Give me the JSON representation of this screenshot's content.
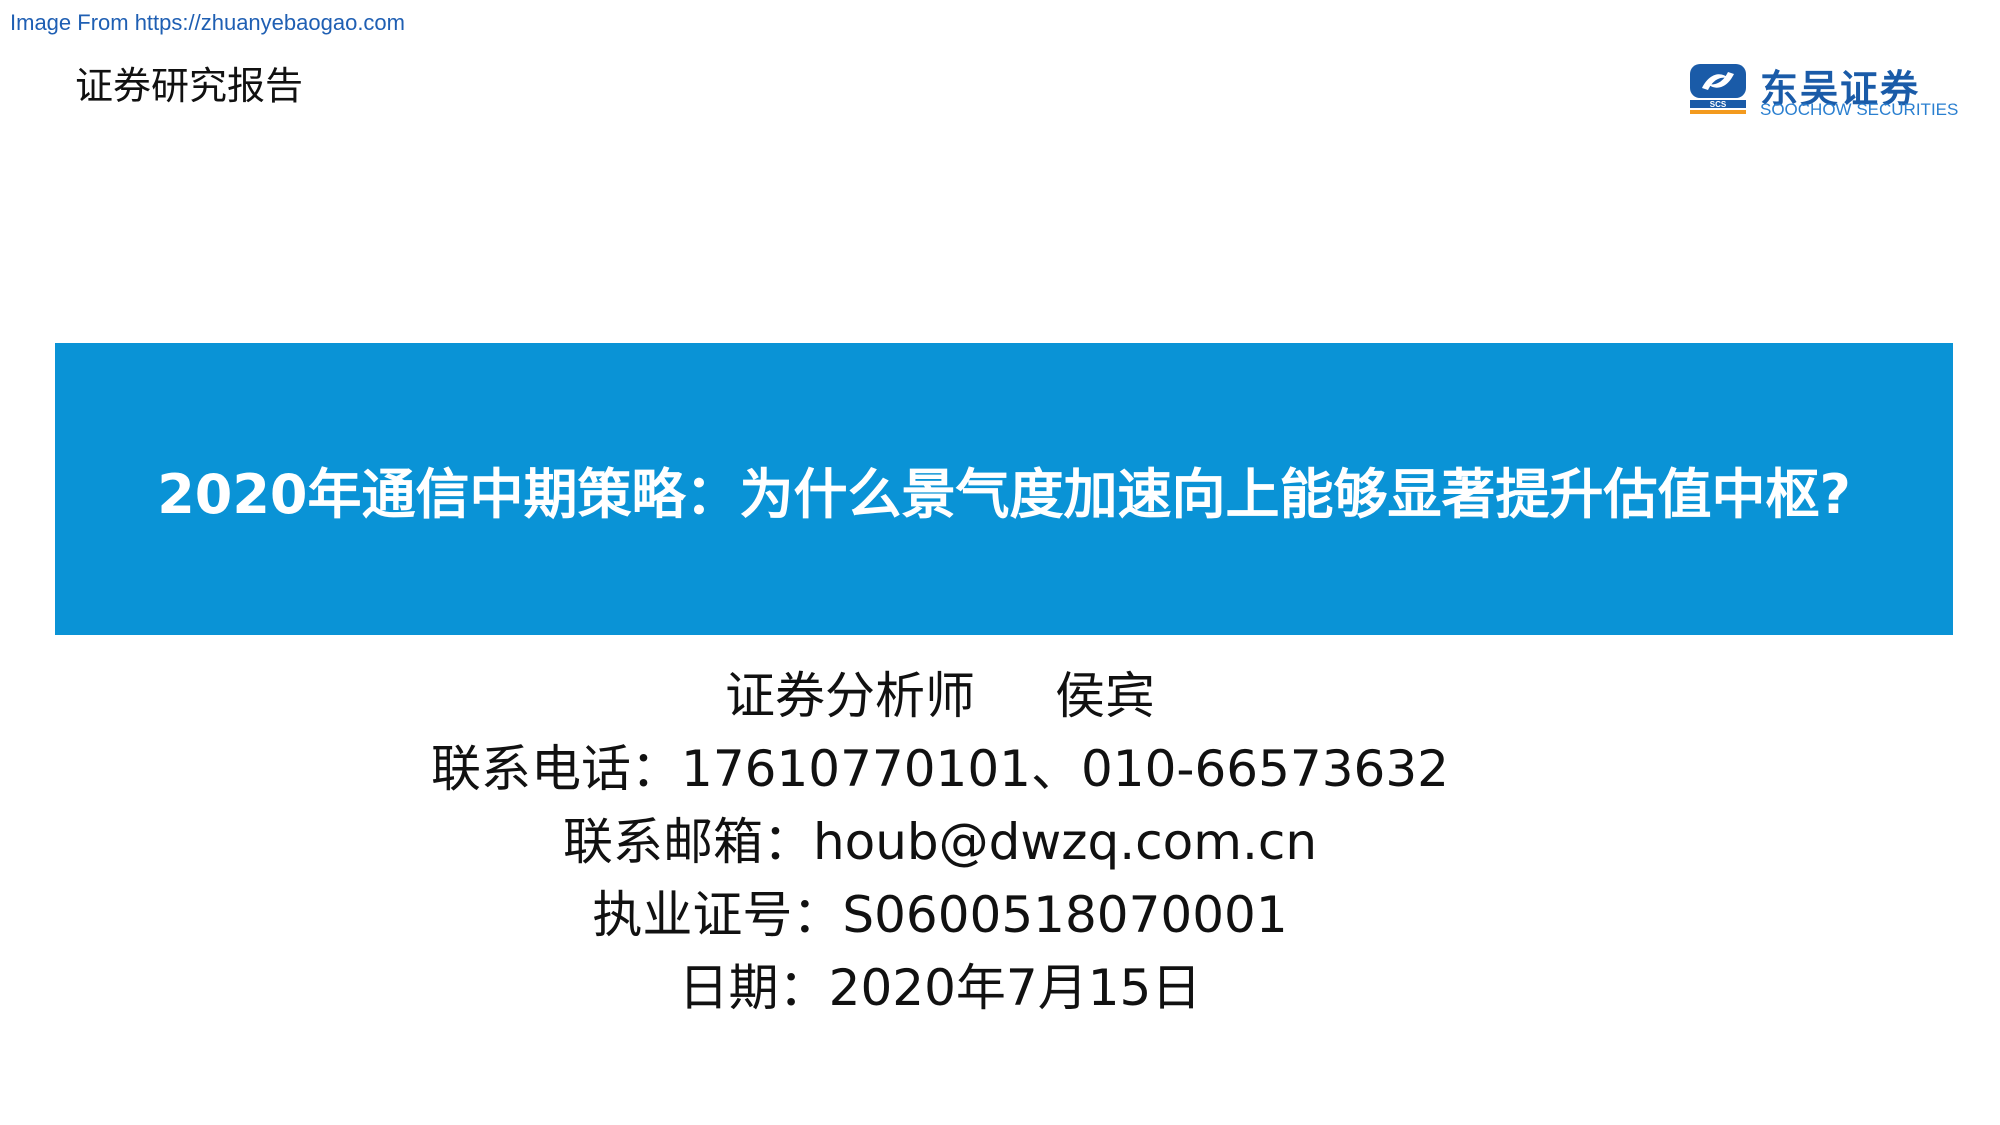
{
  "watermark": "Image From https://zhuanyebaogao.com",
  "header": {
    "doc_type": "证券研究报告",
    "logo": {
      "icon": "scs-logo-icon",
      "cn_name": "东吴证券",
      "en_name": "SOOCHOW SECURITIES",
      "abbr": "SCS",
      "brand_color": "#1a5ba8",
      "accent_color": "#f39a1e"
    }
  },
  "banner": {
    "title": "2020年通信中期策略：为什么景气度加速向上能够显著提升估值中枢?",
    "background_color": "#0a93d6"
  },
  "info": {
    "analyst_label": "证券分析师",
    "analyst_name": "侯宾",
    "phone": "联系电话：17610770101、010-66573632",
    "email": "联系邮箱：houb@dwzq.com.cn",
    "license": "执业证号：S0600518070001",
    "date": "日期：2020年7月15日"
  }
}
